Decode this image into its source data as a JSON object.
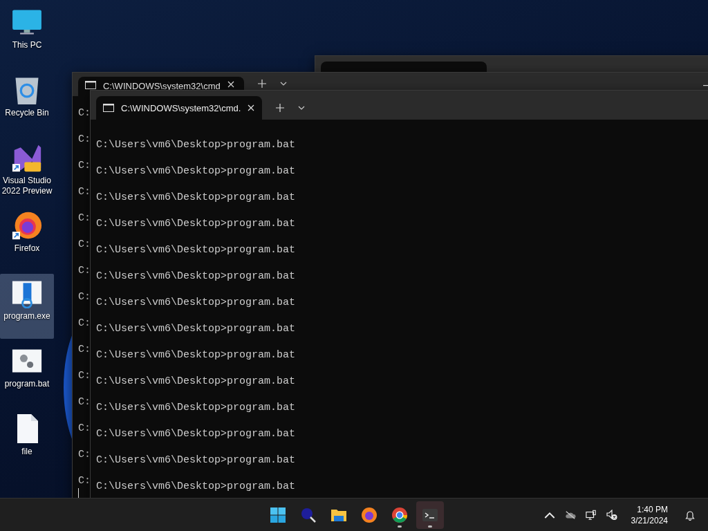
{
  "desktop_icons": [
    {
      "kind": "pc",
      "label": "This PC",
      "selected": false
    },
    {
      "kind": "recycle",
      "label": "Recycle Bin",
      "selected": false
    },
    {
      "kind": "vs",
      "label": "Visual Studio 2022 Preview",
      "selected": false
    },
    {
      "kind": "firefox",
      "label": "Firefox",
      "selected": false
    },
    {
      "kind": "exe",
      "label": "program.exe",
      "selected": true
    },
    {
      "kind": "bat",
      "label": "program.bat",
      "selected": false
    },
    {
      "kind": "file",
      "label": "file",
      "selected": false
    }
  ],
  "windows": [
    {
      "tab_title": "C:\\WINDOWS\\system32\\cmd",
      "show_minimize": true,
      "cursor": true,
      "lines": [
        "C:",
        "C:",
        "C:",
        "C:",
        "C:",
        "C:",
        "C:",
        "C:",
        "C:",
        "C:",
        "C:",
        "C:",
        "C:",
        "C:",
        "C:"
      ]
    },
    {
      "tab_title": "C:\\WINDOWS\\system32\\cmd.",
      "show_minimize": false,
      "cursor": false,
      "lines": [
        "C:\\Users\\vm6\\Desktop>program.bat",
        "C:\\Users\\vm6\\Desktop>program.bat",
        "C:\\Users\\vm6\\Desktop>program.bat",
        "C:\\Users\\vm6\\Desktop>program.bat",
        "C:\\Users\\vm6\\Desktop>program.bat",
        "C:\\Users\\vm6\\Desktop>program.bat",
        "C:\\Users\\vm6\\Desktop>program.bat",
        "C:\\Users\\vm6\\Desktop>program.bat",
        "C:\\Users\\vm6\\Desktop>program.bat",
        "C:\\Users\\vm6\\Desktop>program.bat",
        "C:\\Users\\vm6\\Desktop>program.bat",
        "C:\\Users\\vm6\\Desktop>program.bat",
        "C:\\Users\\vm6\\Desktop>program.bat",
        "C:\\Users\\vm6\\Desktop>program.bat"
      ]
    }
  ],
  "taskbar": {
    "apps": [
      {
        "kind": "start",
        "running": false,
        "selected": false
      },
      {
        "kind": "search",
        "running": false,
        "selected": false
      },
      {
        "kind": "explorer",
        "running": false,
        "selected": false
      },
      {
        "kind": "firefox",
        "running": false,
        "selected": false
      },
      {
        "kind": "chrome",
        "running": true,
        "selected": false
      },
      {
        "kind": "terminal",
        "running": true,
        "selected": true
      }
    ],
    "clock": {
      "time": "1:40 PM",
      "date": "3/21/2024"
    }
  }
}
